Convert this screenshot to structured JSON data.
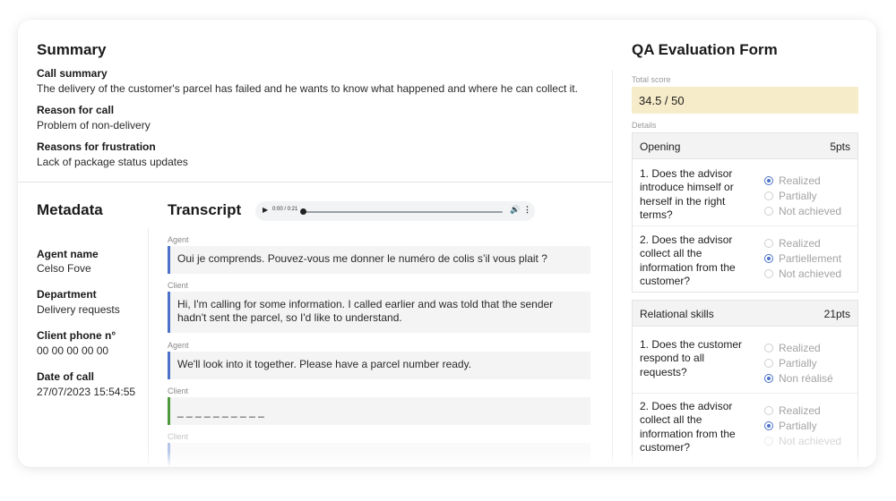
{
  "summary": {
    "title": "Summary",
    "call_summary_label": "Call summary",
    "call_summary": "The delivery of the customer's parcel has failed and he wants to know what happened and where he can collect it.",
    "reason_label": "Reason for call",
    "reason": "Problem of non-delivery",
    "frustration_label": "Reasons for frustration",
    "frustration": "Lack of package status updates"
  },
  "metadata": {
    "title": "Metadata",
    "fields": [
      {
        "label": "Agent name",
        "value": "Celso Fove"
      },
      {
        "label": "Department",
        "value": "Delivery requests"
      },
      {
        "label": "Client phone n°",
        "value": "00 00 00 00 00"
      },
      {
        "label": "Date of call",
        "value": "27/07/2023 15:54:55"
      }
    ]
  },
  "transcript": {
    "title": "Transcript",
    "audio_time": "0:00 / 0:21",
    "messages": [
      {
        "speaker": "Agent",
        "text": "Oui je comprends. Pouvez-vous me donner le numéro de colis s’il vous plait ?",
        "color": "#4b72c8"
      },
      {
        "speaker": "Client",
        "text": "Hi, I'm calling for some information. I called earlier and was told that the sender hadn't sent the parcel, so I'd like to understand.",
        "color": "#4b72c8"
      },
      {
        "speaker": "Agent",
        "text": "We'll look into it together. Please have a parcel number ready.",
        "color": "#4b72c8"
      },
      {
        "speaker": "Client",
        "text": "_ _ _ _ _ _ _ _  _ _",
        "color": "#4c9a3a"
      },
      {
        "speaker": "Client",
        "text": "",
        "color": "#4b72c8"
      }
    ]
  },
  "qa": {
    "title": "QA Evaluation Form",
    "total_label": "Total score",
    "total": "34.5 / 50",
    "details_label": "Details",
    "sections": [
      {
        "name": "Opening",
        "points": "5pts",
        "questions": [
          {
            "text": "1. Does the advisor introduce himself or herself in the right terms?",
            "options": [
              "Realized",
              "Partially",
              "Not achieved"
            ],
            "selected": 0
          },
          {
            "text": "2. Does the advisor collect all the information from the customer?",
            "options": [
              "Realized",
              "Partiellement",
              "Not achieved"
            ],
            "selected": 1
          }
        ]
      },
      {
        "name": "Relational skills",
        "points": "21pts",
        "questions": [
          {
            "text": "1. Does the customer respond to all requests?",
            "options": [
              "Realized",
              "Partially",
              "Non réalisé"
            ],
            "selected": 2
          },
          {
            "text": "2. Does the advisor collect all the information from the customer?",
            "options": [
              "Realized",
              "Partially",
              "Not achieved"
            ],
            "selected": 1
          }
        ]
      }
    ]
  },
  "colors": {
    "accent_blue": "#4b72c8",
    "accent_green": "#4c9a3a",
    "score_bg": "#f7ecc9"
  }
}
